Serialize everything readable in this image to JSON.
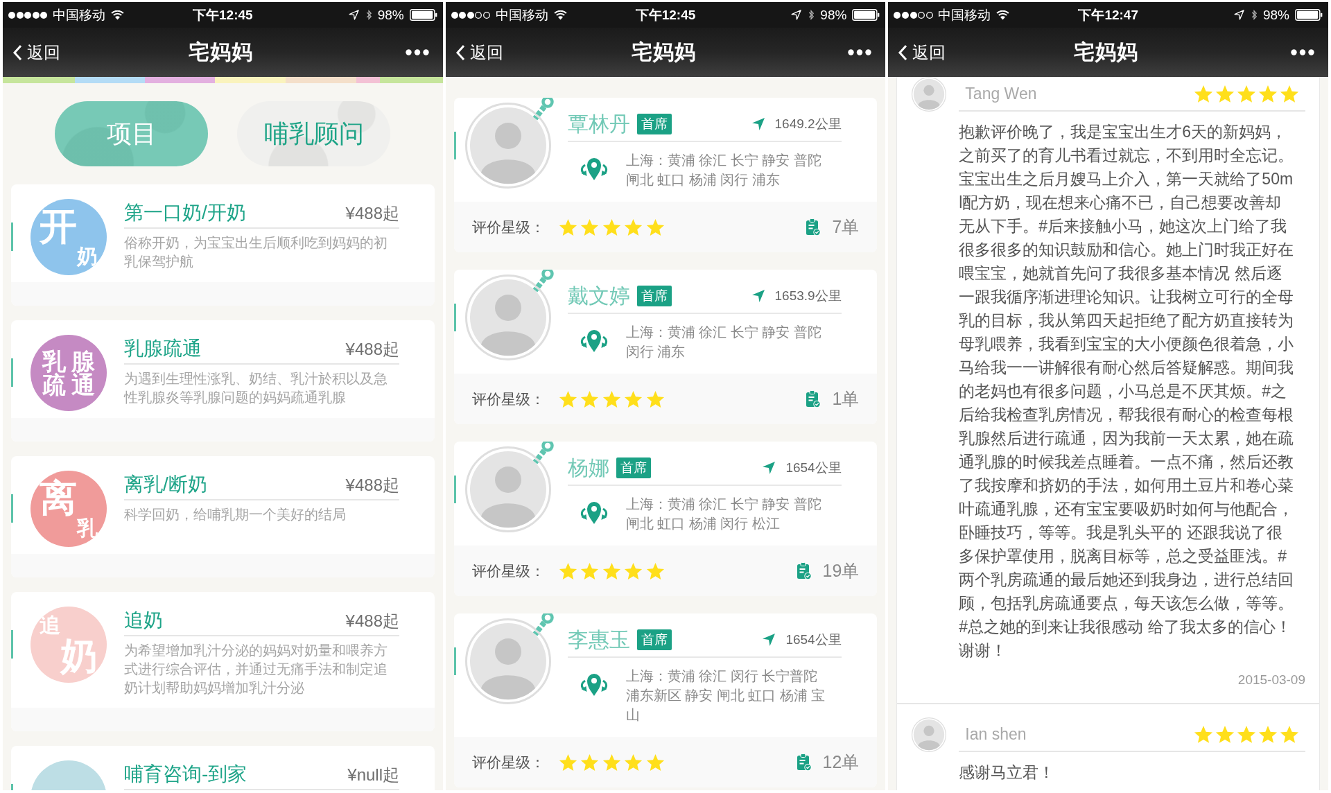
{
  "panels": [
    {
      "kind": "services",
      "status_bar": {
        "signal_dots": [
          {
            "on": true
          },
          {
            "on": true
          },
          {
            "on": true
          },
          {
            "on": true
          },
          {
            "on": true
          }
        ],
        "carrier": "中国移动",
        "time": "下午12:45",
        "battery": "98%"
      },
      "nav": {
        "back": "返回",
        "title": "宅妈妈"
      },
      "tabs": [
        {
          "label": "项目",
          "selected": true
        },
        {
          "label": "哺乳顾问",
          "selected": false
        }
      ],
      "services": [
        {
          "title": "第一口奶/开奶",
          "price": "¥488起",
          "description": "俗称开奶，为宝宝出生后顺利吃到妈妈的初乳保驾护航",
          "logo": {
            "color": "#8ec4ec",
            "parts": [
              {
                "text": "开",
                "big": true
              },
              {
                "text": "奶",
                "big": false
              }
            ]
          }
        },
        {
          "title": "乳腺疏通",
          "price": "¥488起",
          "description": "为遇到生理性涨乳、奶结、乳汁於积以及急性乳腺炎等乳腺问题的妈妈疏通乳腺",
          "logo": {
            "color": "#c58ac3",
            "parts": [
              {
                "text": "乳",
                "big": false
              },
              {
                "text": "腺",
                "big": false
              },
              {
                "text": "疏",
                "big": false
              },
              {
                "text": "通",
                "big": false
              }
            ]
          }
        },
        {
          "title": "离乳/断奶",
          "price": "¥488起",
          "description": "科学回奶，给哺乳期一个美好的结局",
          "logo": {
            "color": "#f09b9a",
            "parts": [
              {
                "text": "离",
                "big": true
              },
              {
                "text": "乳",
                "big": false
              }
            ]
          }
        },
        {
          "title": "追奶",
          "price": "¥488起",
          "description": "为希望增加乳汁分泌的妈妈对奶量和喂养方式进行综合评估，并通过无痛手法和制定追奶计划帮助妈妈增加乳汁分泌",
          "logo": {
            "color": "#f8cfcc",
            "parts": [
              {
                "text": "追",
                "big": false
              },
              {
                "text": "奶",
                "big": true
              }
            ]
          }
        },
        {
          "title": "哺育咨询-到家",
          "price": "¥null起",
          "logo": {
            "color": "#bddee5"
          }
        }
      ]
    },
    {
      "kind": "consultants",
      "status_bar": {
        "signal_dots": [
          {
            "on": true
          },
          {
            "on": true
          },
          {
            "on": true
          },
          {
            "on": false
          },
          {
            "on": false
          }
        ],
        "carrier": "中国移动",
        "time": "下午12:45",
        "battery": "98%"
      },
      "nav": {
        "back": "返回",
        "title": "宅妈妈"
      },
      "consultants": [
        {
          "name": "覃林丹",
          "badge": "首席",
          "distance": "1649.2公里",
          "area": "上海：黄浦 徐汇 长宁 静安 普陀闸北 虹口 杨浦 闵行 浦东",
          "rating_label": "评价星级：",
          "stars": 5,
          "orders": "7单"
        },
        {
          "name": "戴文婷",
          "badge": "首席",
          "distance": "1653.9公里",
          "area": "上海：黄浦 徐汇 长宁 静安 普陀闵行 浦东",
          "rating_label": "评价星级：",
          "stars": 5,
          "orders": "1单"
        },
        {
          "name": "杨娜",
          "badge": "首席",
          "distance": "1654公里",
          "area": "上海：黄浦 徐汇 长宁 静安 普陀闸北 虹口 杨浦 闵行 松江",
          "rating_label": "评价星级：",
          "stars": 5,
          "orders": "19单"
        },
        {
          "name": "李惠玉",
          "badge": "首席",
          "distance": "1654公里",
          "area": "上海：黄浦 徐汇 闵行 长宁普陀浦东新区 静安 闸北 虹口 杨浦 宝山",
          "rating_label": "评价星级：",
          "stars": 5,
          "orders": "12单"
        }
      ]
    },
    {
      "kind": "reviews",
      "status_bar": {
        "signal_dots": [
          {
            "on": true
          },
          {
            "on": true
          },
          {
            "on": true
          },
          {
            "on": false
          },
          {
            "on": false
          }
        ],
        "carrier": "中国移动",
        "time": "下午12:47",
        "battery": "98%"
      },
      "nav": {
        "back": "返回",
        "title": "宅妈妈"
      },
      "reviews": [
        {
          "name": "Tang Wen",
          "stars": 5,
          "text": "抱歉评价晚了，我是宝宝出生才6天的新妈妈，之前买了的育儿书看过就忘，不到用时全忘记。宝宝出生之后月嫂马上介入，第一天就给了50ml配方奶，现在想来心痛不已，自己想要改善却无从下手。#后来接触小马，她这次上门给了我很多很多的知识鼓励和信心。她上门时我正好在喂宝宝，她就首先问了我很多基本情况 然后逐一跟我循序渐进理论知识。让我树立可行的全母乳的目标，我从第四天起拒绝了配方奶直接转为母乳喂养，我看到宝宝的大小便颜色很着急，小马给我一一讲解很有耐心然后答疑解惑。期间我的老妈也有很多问题，小马总是不厌其烦。#之后给我检查乳房情况，帮我很有耐心的检查每根乳腺然后进行疏通，因为我前一天太累，她在疏通乳腺的时候我差点睡着。一点不痛，然后还教了我按摩和挤奶的手法，如何用土豆片和卷心菜叶疏通乳腺，还有宝宝要吸奶时如何与他配合，卧睡技巧，等等。我是乳头平的 还跟我说了很多保护罩使用，脱离目标等，总之受益匪浅。#两个乳房疏通的最后她还到我身边，进行总结回顾，包括乳房疏通要点，每天该怎么做，等等。#总之她的到来让我很感动 给了我太多的信心！谢谢！",
          "date": "2015-03-09"
        },
        {
          "name": "Ian shen",
          "stars": 5,
          "text": "感谢马立君！"
        }
      ]
    }
  ]
}
